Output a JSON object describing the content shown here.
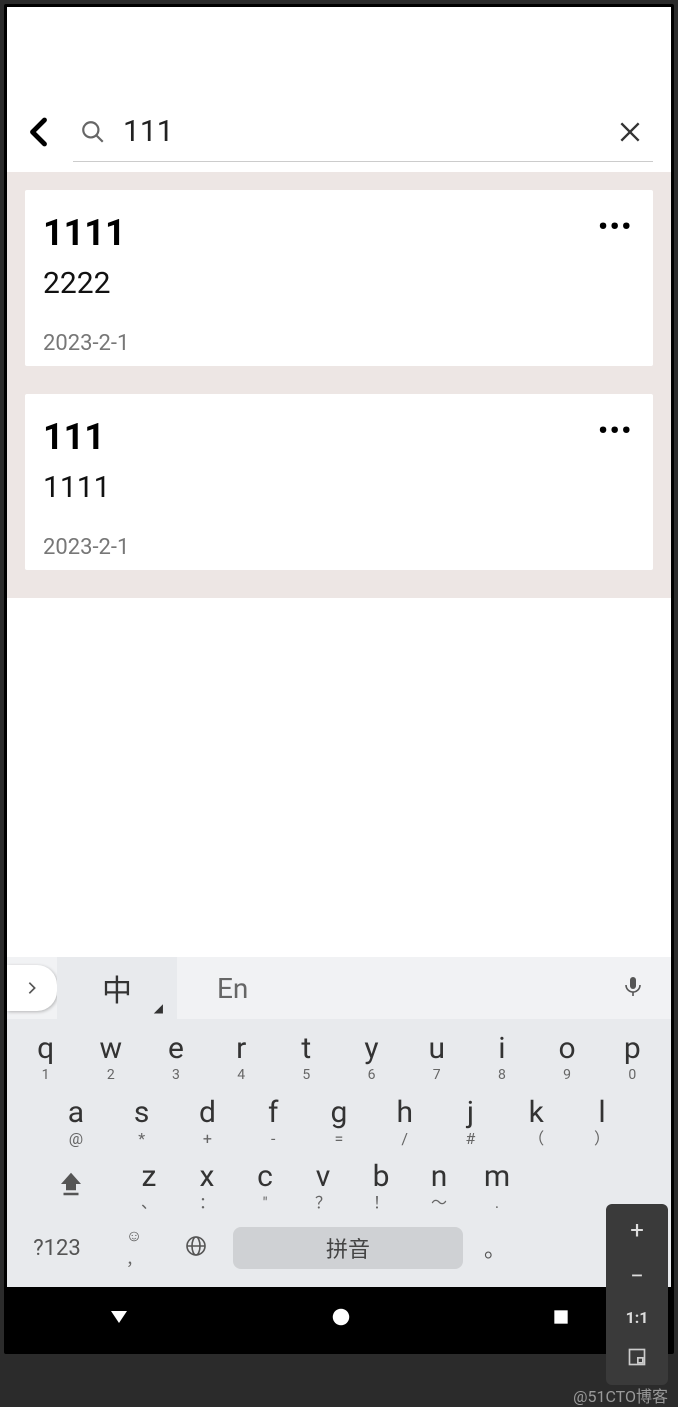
{
  "search": {
    "value": "111"
  },
  "results": [
    {
      "title": "1111",
      "body": "2222",
      "date": "2023-2-1"
    },
    {
      "title": "111",
      "body": "1111",
      "date": "2023-2-1"
    }
  ],
  "keyboard": {
    "mode_cn": "中",
    "mode_en": "En",
    "row1": [
      {
        "main": "q",
        "sub": "1"
      },
      {
        "main": "w",
        "sub": "2"
      },
      {
        "main": "e",
        "sub": "3"
      },
      {
        "main": "r",
        "sub": "4"
      },
      {
        "main": "t",
        "sub": "5"
      },
      {
        "main": "y",
        "sub": "6"
      },
      {
        "main": "u",
        "sub": "7"
      },
      {
        "main": "i",
        "sub": "8"
      },
      {
        "main": "o",
        "sub": "9"
      },
      {
        "main": "p",
        "sub": "0"
      }
    ],
    "row2": [
      {
        "main": "a",
        "sub": "@"
      },
      {
        "main": "s",
        "sub": "*"
      },
      {
        "main": "d",
        "sub": "+"
      },
      {
        "main": "f",
        "sub": "-"
      },
      {
        "main": "g",
        "sub": "="
      },
      {
        "main": "h",
        "sub": "/"
      },
      {
        "main": "j",
        "sub": "#"
      },
      {
        "main": "k",
        "sub": "（"
      },
      {
        "main": "l",
        "sub": "）"
      }
    ],
    "row3": [
      {
        "main": "z",
        "sub": "、"
      },
      {
        "main": "x",
        "sub": "："
      },
      {
        "main": "c",
        "sub": "\""
      },
      {
        "main": "v",
        "sub": "？"
      },
      {
        "main": "b",
        "sub": "！"
      },
      {
        "main": "n",
        "sub": "～"
      },
      {
        "main": "m",
        "sub": "."
      }
    ],
    "sym_toggle": "?123",
    "emoji_sub": "，",
    "space_label": "拼音",
    "period": "。"
  },
  "zoom": {
    "plus": "+",
    "minus": "−",
    "one_to_one": "1:1"
  },
  "watermark": "@51CTO博客"
}
